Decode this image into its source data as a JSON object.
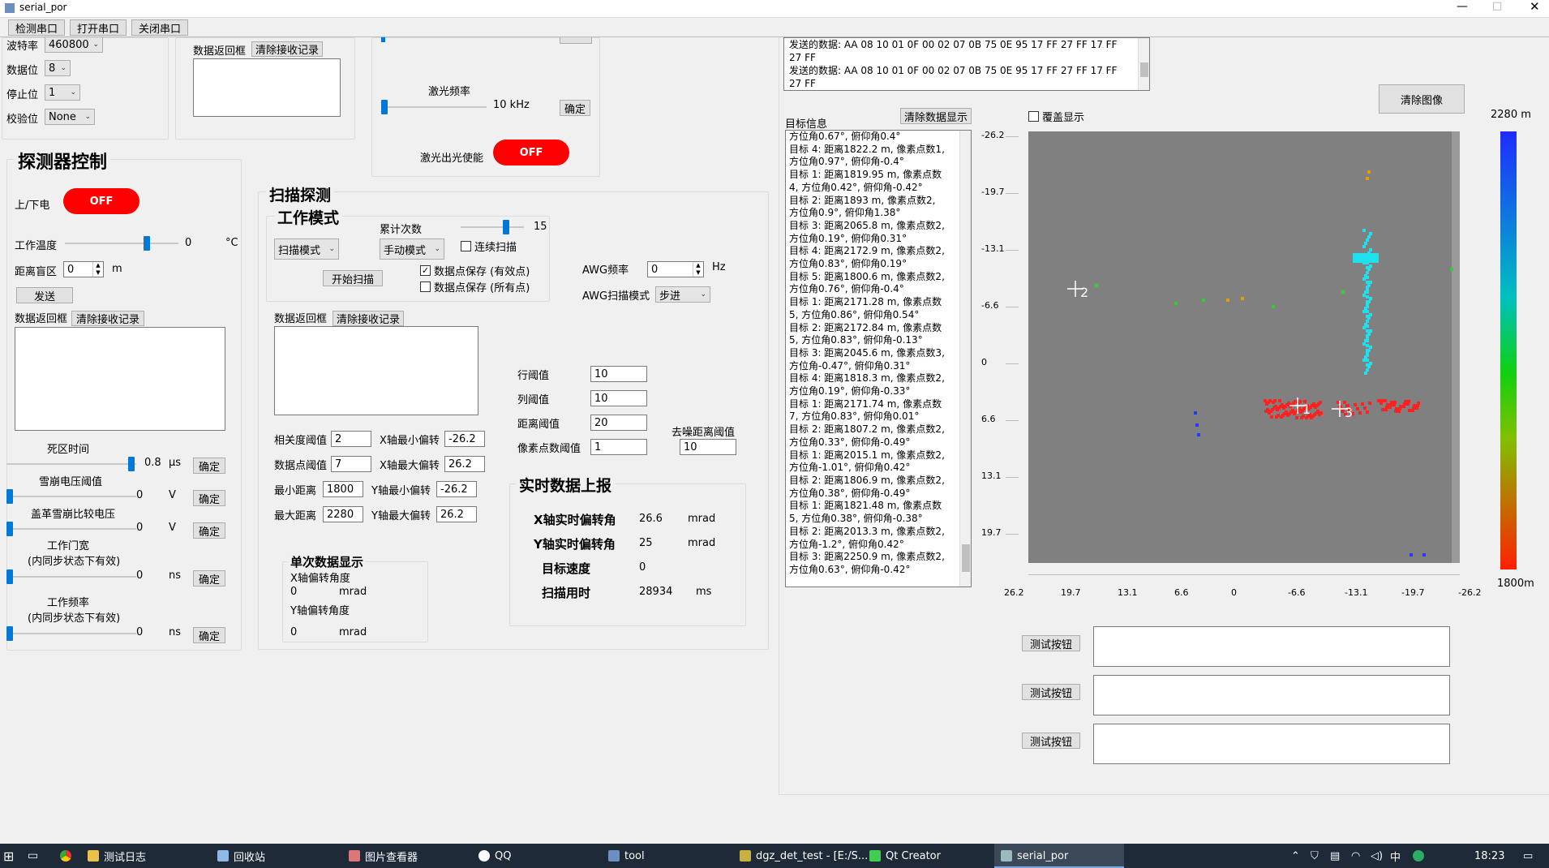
{
  "window": {
    "title": "serial_por"
  },
  "toolbar": {
    "detect": "检测串口",
    "open": "打开串口",
    "close": "关闭串口"
  },
  "serial": {
    "baud_label": "波特率",
    "baud": "460800",
    "data_label": "数据位",
    "data": "8",
    "stop_label": "停止位",
    "stop": "1",
    "parity_label": "校验位",
    "parity": "None"
  },
  "top_return": {
    "label": "数据返回框",
    "clear": "清除接收记录"
  },
  "laser": {
    "freq_label": "激光频率",
    "freq_value": "10 kHz",
    "confirm": "确定",
    "enable_label": "激光出光使能",
    "enable_state": "OFF"
  },
  "send_log": {
    "lines": [
      "发送的数据: AA 08 10 01 0F 00 02 07 0B 75 0E 95 17 FF 27 FF 17 FF",
      "27 FF",
      "发送的数据: AA 08 10 01 0F 00 02 07 0B 75 0E 95 17 FF 27 FF 17 FF",
      "27 FF"
    ]
  },
  "detector": {
    "title": "探测器控制",
    "power_label": "上/下电",
    "power_state": "OFF",
    "temp_label": "工作温度",
    "temp_value": "0",
    "temp_unit": "°C",
    "blind_label": "距离盲区",
    "blind_value": "0",
    "blind_unit": "m",
    "send": "发送",
    "return_label": "数据返回框",
    "clear": "清除接收记录",
    "dead_label": "死区时间",
    "dead_value": "0.8",
    "dead_unit": "μs",
    "avalanche_label": "雪崩电压阈值",
    "avalanche_value": "0",
    "avalanche_unit": "V",
    "geiger_label": "盖革雪崩比较电压",
    "geiger_value": "0",
    "geiger_unit": "V",
    "gate_label": "工作门宽",
    "gate_sub": "(内同步状态下有效)",
    "gate_value": "0",
    "gate_unit": "ns",
    "freq_label": "工作频率",
    "freq_sub": "(内同步状态下有效)",
    "freq_value": "0",
    "freq_unit": "ns",
    "confirm": "确定"
  },
  "scan": {
    "title": "扫描探测",
    "mode_title": "工作模式",
    "mode": "扫描模式",
    "accum_label": "累计次数",
    "accum_value": "15",
    "accum_mode": "手动模式",
    "continuous": "连续扫描",
    "start": "开始扫描",
    "save_valid": "数据点保存 (有效点)",
    "save_all": "数据点保存 (所有点)",
    "awg_freq_label": "AWG频率",
    "awg_freq": "0",
    "awg_freq_unit": "Hz",
    "awg_mode_label": "AWG扫描模式",
    "awg_mode": "步进",
    "return_label": "数据返回框",
    "clear": "清除接收记录",
    "corr_label": "相关度阈值",
    "corr": "2",
    "xmin_label": "X轴最小偏转",
    "xmin": "-26.2",
    "pts_label": "数据点阈值",
    "pts": "7",
    "xmax_label": "X轴最大偏转",
    "xmax": "26.2",
    "dmin_label": "最小距离",
    "dmin": "1800",
    "ymin_label": "Y轴最小偏转",
    "ymin": "-26.2",
    "dmax_label": "最大距离",
    "dmax": "2280",
    "ymax_label": "Y轴最大偏转",
    "ymax": "26.2",
    "row_label": "行阈值",
    "row": "10",
    "col_label": "列阈值",
    "col": "10",
    "dist_label": "距离阈值",
    "dist": "20",
    "pix_label": "像素点数阈值",
    "pix": "1",
    "denoise_label": "去噪距离阈值",
    "denoise": "10"
  },
  "single": {
    "title": "单次数据显示",
    "x_label": "X轴偏转角度",
    "x_value": "0",
    "x_unit": "mrad",
    "y_label": "Y轴偏转角度",
    "y_value": "0",
    "y_unit": "mrad"
  },
  "realtime": {
    "title": "实时数据上报",
    "x_label": "X轴实时偏转角",
    "x_value": "26.6",
    "x_unit": "mrad",
    "y_label": "Y轴实时偏转角",
    "y_value": "25",
    "y_unit": "mrad",
    "speed_label": "目标速度",
    "speed_value": "0",
    "time_label": "扫描用时",
    "time_value": "28934",
    "time_unit": "ms"
  },
  "targets": {
    "label": "目标信息",
    "clear": "清除数据显示",
    "lines": [
      "方位角0.67°, 俯仰角0.4°",
      "目标 4:  距离1822.2 m, 像素点数1,",
      "方位角0.97°, 俯仰角-0.4°",
      "目标 1:  距离1819.95 m, 像素点数",
      "4, 方位角0.42°, 俯仰角-0.42°",
      "目标 2:  距离1893 m, 像素点数2,",
      "方位角0.9°, 俯仰角1.38°",
      "目标 3:  距离2065.8 m, 像素点数2,",
      "方位角0.19°, 俯仰角0.31°",
      "目标 4:  距离2172.9 m, 像素点数2,",
      "方位角0.83°, 俯仰角0.19°",
      "目标 5:  距离1800.6 m, 像素点数2,",
      "方位角0.76°, 俯仰角-0.4°",
      "目标 1:  距离2171.28 m, 像素点数",
      "5, 方位角0.86°, 俯仰角0.54°",
      "目标 2:  距离2172.84 m, 像素点数",
      "5, 方位角0.83°, 俯仰角-0.13°",
      "目标 3:  距离2045.6 m, 像素点数3,",
      "方位角-0.47°, 俯仰角0.31°",
      "目标 4:  距离1818.3 m, 像素点数2,",
      "方位角0.19°, 俯仰角-0.33°",
      "目标 1:  距离2171.74 m, 像素点数",
      "7, 方位角0.83°, 俯仰角0.01°",
      "目标 2:  距离1807.2 m, 像素点数2,",
      "方位角0.33°, 俯仰角-0.49°",
      "目标 1:  距离2015.1 m, 像素点数2,",
      "方位角-1.01°, 俯仰角0.42°",
      "目标 2:  距离1806.9 m, 像素点数2,",
      "方位角0.38°, 俯仰角-0.49°",
      "目标 1:  距离1821.48 m, 像素点数",
      "5, 方位角0.38°, 俯仰角-0.38°",
      "目标 2:  距离2013.3 m, 像素点数2,",
      "方位角-1.2°, 俯仰角0.42°",
      "目标 3:  距离2250.9 m, 像素点数2,",
      "方位角0.63°, 俯仰角-0.42°"
    ]
  },
  "image": {
    "overlay": "覆盖显示",
    "clear": "清除图像",
    "y_ticks": [
      "-26.2",
      "-19.7",
      "-13.1",
      "-6.6",
      "0",
      "6.6",
      "13.1",
      "19.7"
    ],
    "x_ticks": [
      "26.2",
      "19.7",
      "13.1",
      "6.6",
      "0",
      "-6.6",
      "-13.1",
      "-19.7",
      "-26.2"
    ],
    "colorbar_max": "2280 m",
    "colorbar_min": "1800m",
    "marker_labels": [
      "1",
      "2",
      "3"
    ],
    "colors": {
      "background": "#808080",
      "near": "#ff2020",
      "far": "#1e3cff",
      "cyan": "#20e0f0",
      "green": "#30d030"
    }
  },
  "test": {
    "label": "测试按钮"
  },
  "taskbar": {
    "items": [
      "测试日志",
      "回收站",
      "图片查看器",
      "QQ",
      "tool",
      "dgz_det_test - [E:/S...",
      "Qt Creator",
      "serial_por"
    ],
    "time": "18:23",
    "ime": "中"
  }
}
